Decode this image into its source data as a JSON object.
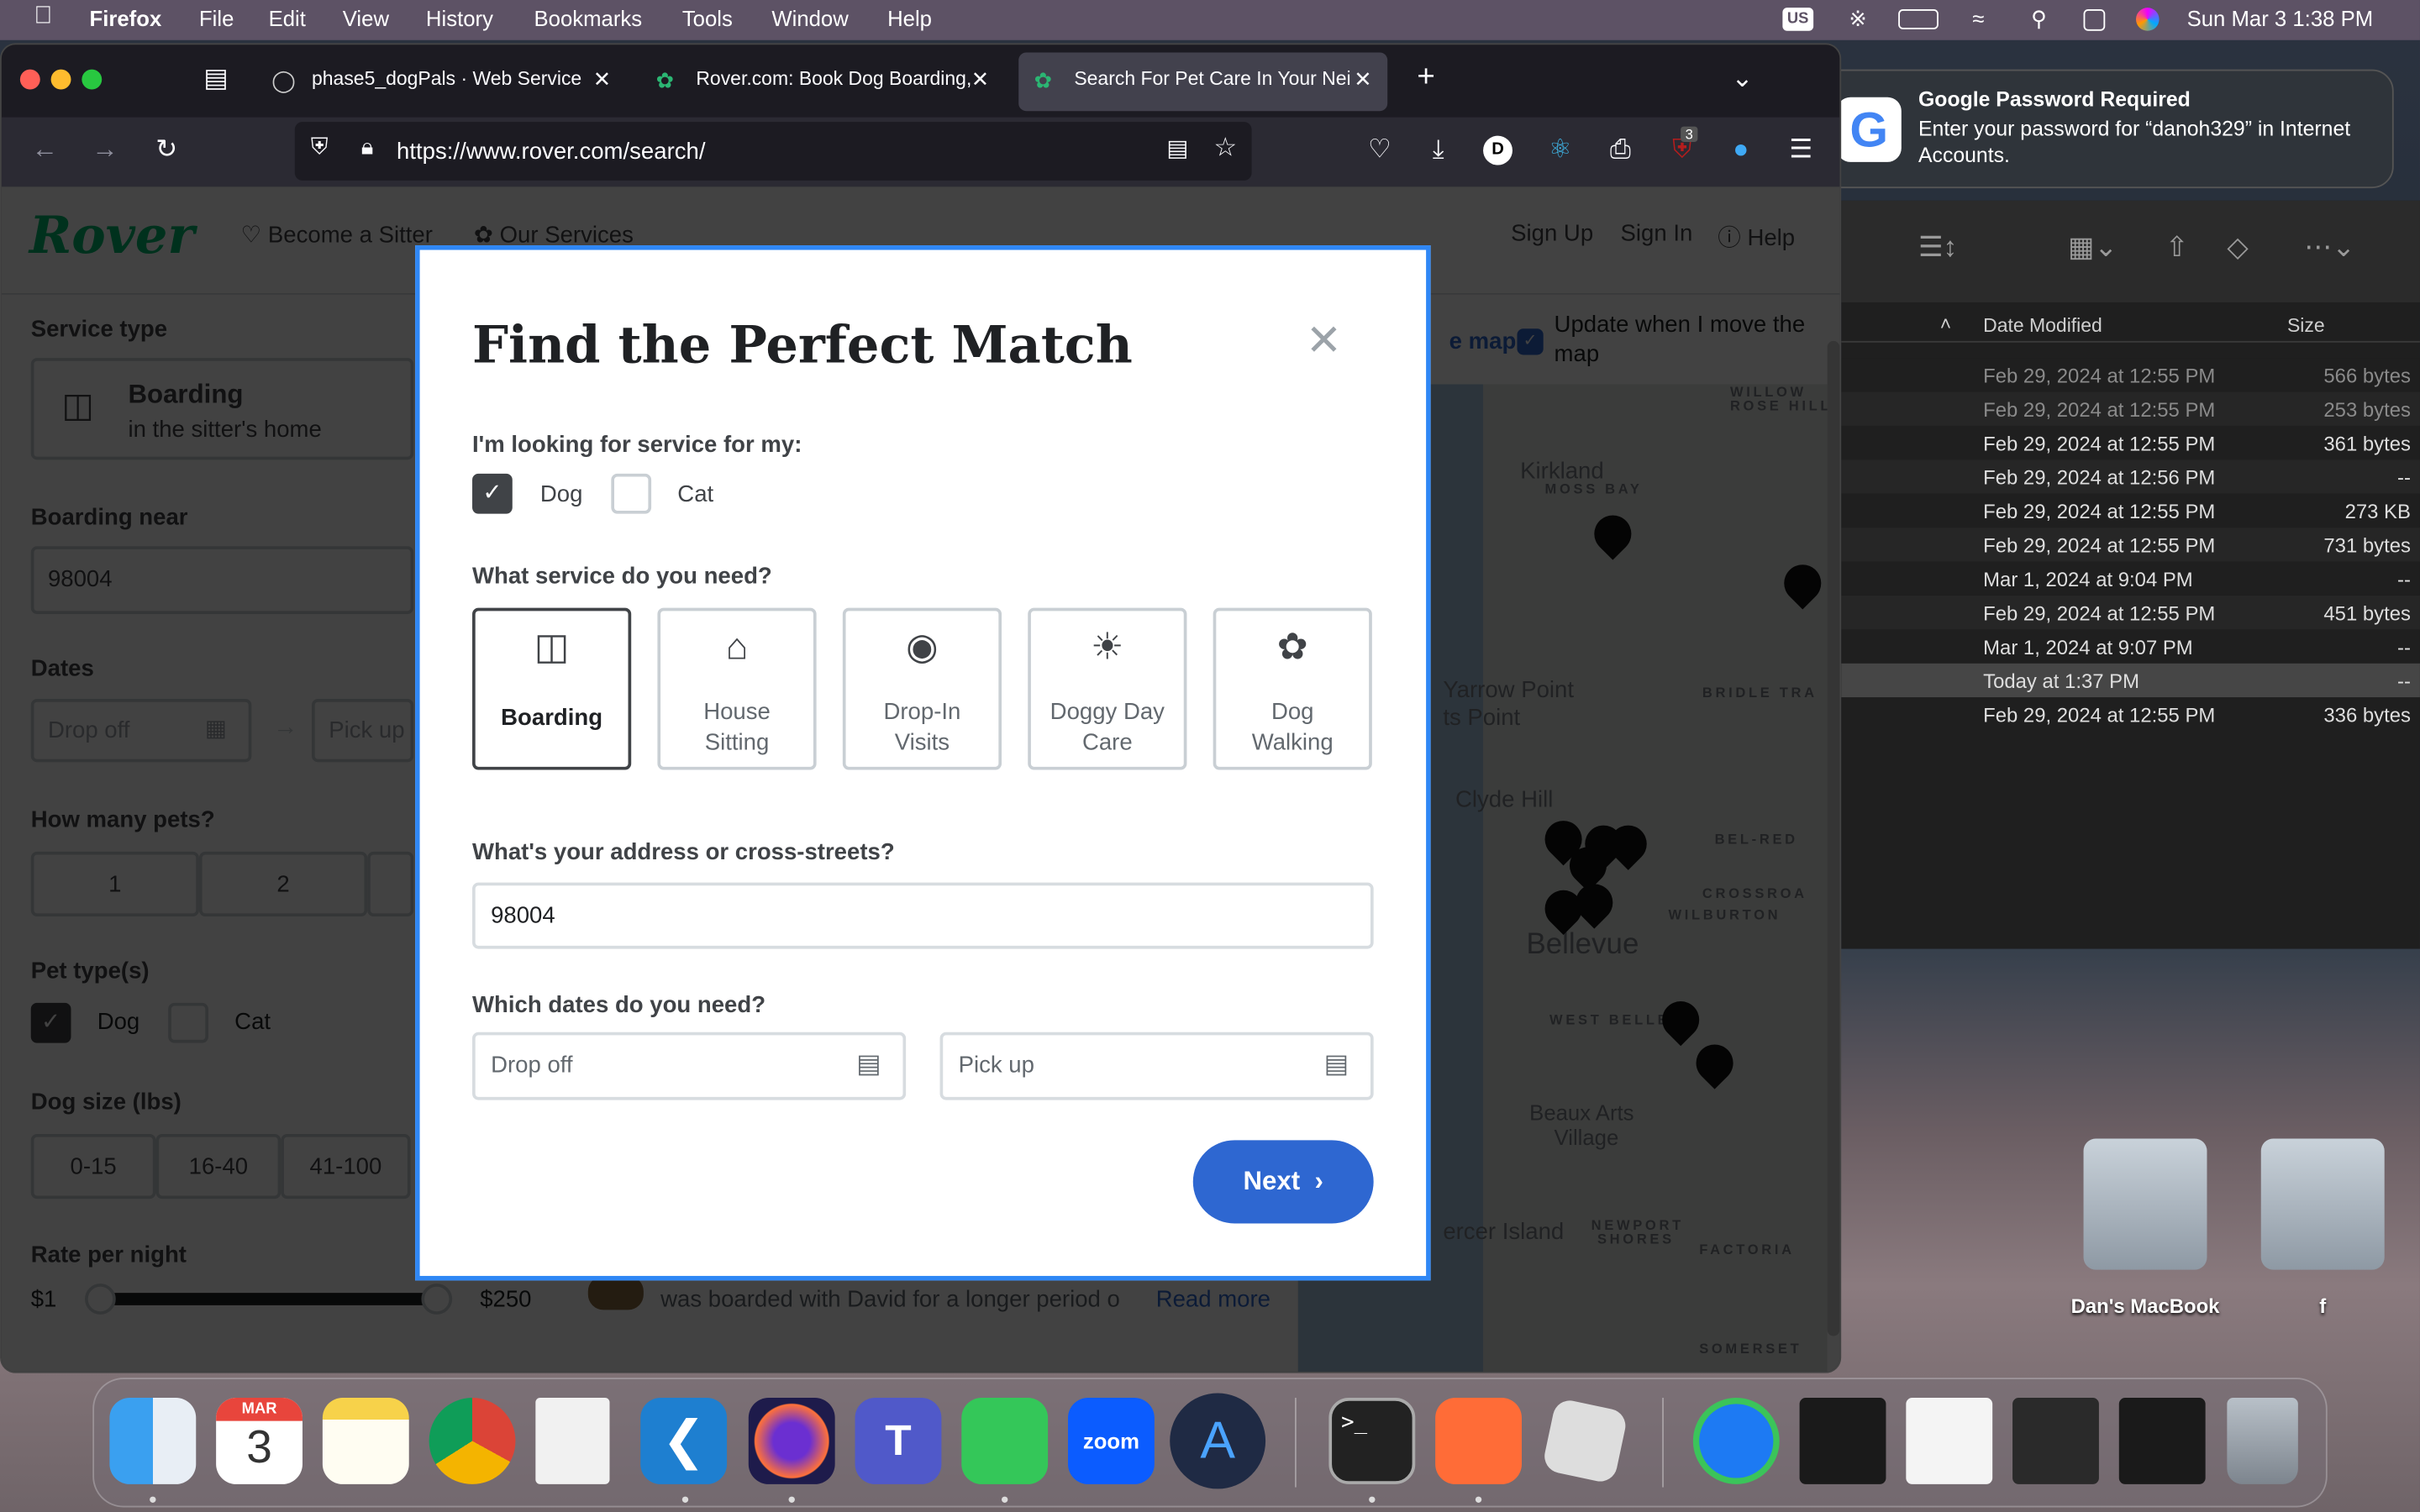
{
  "menubar": {
    "app": "Firefox",
    "items": [
      "File",
      "Edit",
      "View",
      "History",
      "Bookmarks",
      "Tools",
      "Window",
      "Help"
    ],
    "input_source": "US",
    "clock": "Sun Mar 3  1:38 PM"
  },
  "browser": {
    "tabs": [
      {
        "label": "phase5_dogPals · Web Service"
      },
      {
        "label": "Rover.com: Book Dog Boarding,"
      },
      {
        "label": "Search For Pet Care In Your Nei"
      }
    ],
    "url": "https://www.rover.com/search/",
    "badge_count": "3"
  },
  "rover": {
    "logo": "Rover",
    "nav": {
      "become_sitter": "Become a Sitter",
      "our_services": "Our Services",
      "sign_up": "Sign Up",
      "sign_in": "Sign In",
      "help": "Help"
    },
    "filters": {
      "service_type_label": "Service type",
      "service_name": "Boarding",
      "service_sub": "in the sitter's home",
      "near_label": "Boarding near",
      "near_value": "98004",
      "dates_label": "Dates",
      "drop_off": "Drop off",
      "pick_up": "Pick up",
      "pets_label": "How many pets?",
      "pets": [
        "1",
        "2"
      ],
      "pet_type_label": "Pet type(s)",
      "dog": "Dog",
      "cat": "Cat",
      "dog_size_label": "Dog size (lbs)",
      "sizes": [
        "0-15",
        "16-40",
        "41-100"
      ],
      "rate_label": "Rate per night",
      "rate_min": "$1",
      "rate_max": "$250"
    },
    "review_snippet": "was boarded with David for a longer period o",
    "read_more": "Read more",
    "map": {
      "link_fragment": "e map",
      "update_label": "Update when I move the map",
      "labels": [
        "Kirkland",
        "MOSS BAY",
        "WILLOW",
        "ROSE HILL",
        "Yarrow Point",
        "ts Point",
        "Clyde Hill",
        "BRIDLE TRA",
        "BEL-RED",
        "CROSSROA",
        "WILBURTON",
        "Bellevue",
        "WEST BELLEV",
        "Beaux Arts",
        "Village",
        "ercer Island",
        "NEWPORT",
        "SHORES",
        "FACTORIA",
        "SOMERSET"
      ]
    }
  },
  "modal": {
    "title": "Find the Perfect Match",
    "pet_question": "I'm looking for service for my:",
    "dog": "Dog",
    "cat": "Cat",
    "dog_checked": true,
    "cat_checked": false,
    "service_question": "What service do you need?",
    "services": [
      {
        "label": "Boarding",
        "selected": true
      },
      {
        "label": "House Sitting"
      },
      {
        "label": "Drop-In Visits"
      },
      {
        "label": "Doggy Day Care"
      },
      {
        "label": "Dog Walking"
      }
    ],
    "address_question": "What's your address or cross-streets?",
    "address_value": "98004",
    "dates_question": "Which dates do you need?",
    "drop_off_placeholder": "Drop off",
    "pick_up_placeholder": "Pick up",
    "next": "Next"
  },
  "notification": {
    "title": "Google Password Required",
    "body": "Enter your password for “danoh329” in Internet Accounts."
  },
  "finder": {
    "col_date": "Date Modified",
    "col_size": "Size",
    "rows": [
      {
        "date": "Feb 29, 2024 at 12:55 PM",
        "size": "566 bytes"
      },
      {
        "date": "Feb 29, 2024 at 12:55 PM",
        "size": "253 bytes"
      },
      {
        "date": "Feb 29, 2024 at 12:55 PM",
        "size": "361 bytes"
      },
      {
        "date": "Feb 29, 2024 at 12:56 PM",
        "size": "--"
      },
      {
        "date": "Feb 29, 2024 at 12:55 PM",
        "size": "273 KB"
      },
      {
        "date": "Feb 29, 2024 at 12:55 PM",
        "size": "731 bytes"
      },
      {
        "date": "Mar 1, 2024 at 9:04 PM",
        "size": "--"
      },
      {
        "date": "Feb 29, 2024 at 12:55 PM",
        "size": "451 bytes"
      },
      {
        "date": "Mar 1, 2024 at 9:07 PM",
        "size": "--"
      },
      {
        "date": "Today at 1:37 PM",
        "size": "--"
      },
      {
        "date": "Feb 29, 2024 at 12:55 PM",
        "size": "336 bytes"
      }
    ]
  },
  "desktop": {
    "disks": [
      "Dan's MacBook",
      "f"
    ]
  },
  "dock": {
    "calendar_month": "MAR",
    "calendar_day": "3",
    "zoom_label": "zoom"
  }
}
